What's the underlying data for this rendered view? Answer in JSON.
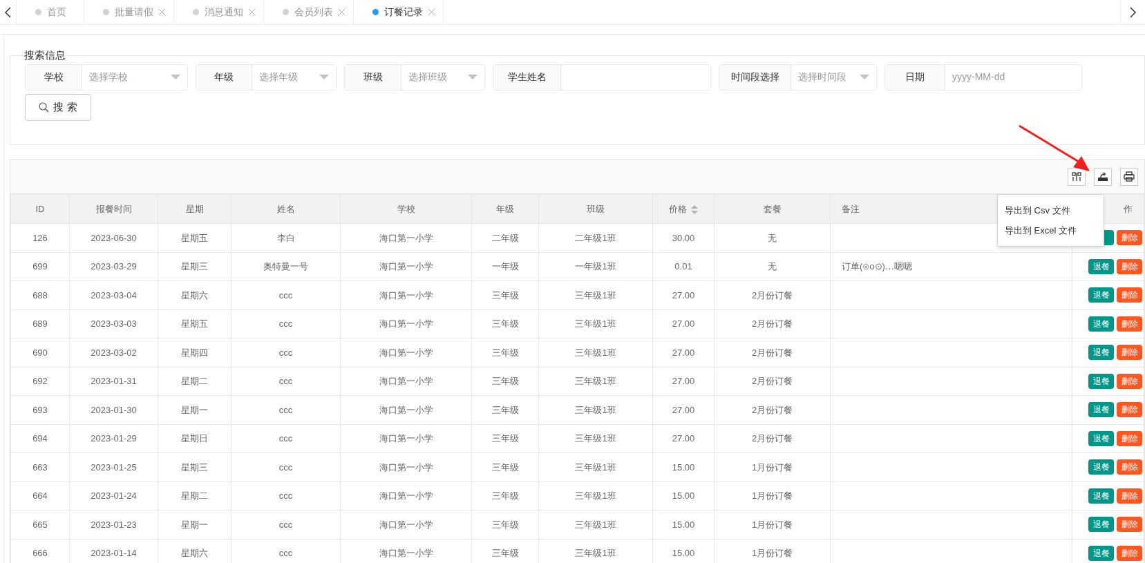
{
  "tabs": [
    {
      "label": "首页",
      "selected": false,
      "closable": false
    },
    {
      "label": "批量请假",
      "selected": false,
      "closable": true
    },
    {
      "label": "消息通知",
      "selected": false,
      "closable": true
    },
    {
      "label": "会员列表",
      "selected": false,
      "closable": true
    },
    {
      "label": "订餐记录",
      "selected": true,
      "closable": true
    }
  ],
  "search": {
    "legend": "搜索信息",
    "fields": [
      {
        "kind": "select",
        "label": "学校",
        "placeholder": "选择学校"
      },
      {
        "kind": "select",
        "label": "年级",
        "placeholder": "选择年级"
      },
      {
        "kind": "select",
        "label": "班级",
        "placeholder": "选择班级"
      },
      {
        "kind": "input",
        "label": "学生姓名"
      },
      {
        "kind": "select",
        "label": "时间段选择",
        "placeholder": "选择时间段"
      },
      {
        "kind": "input",
        "label": "日期",
        "placeholder": "yyyy-MM-dd"
      }
    ],
    "button": "搜 索"
  },
  "export_menu": [
    "导出到 Csv 文件",
    "导出到 Excel 文件"
  ],
  "table": {
    "columns": [
      {
        "label": "ID",
        "sortable": false
      },
      {
        "label": "报餐时间",
        "sortable": false
      },
      {
        "label": "星期",
        "sortable": false
      },
      {
        "label": "姓名",
        "sortable": false
      },
      {
        "label": "学校",
        "sortable": false
      },
      {
        "label": "年级",
        "sortable": false
      },
      {
        "label": "班级",
        "sortable": false
      },
      {
        "label": "价格",
        "sortable": true
      },
      {
        "label": "套餐",
        "sortable": false
      },
      {
        "label": "备注",
        "sortable": false
      },
      {
        "label": "作",
        "sortable": false
      }
    ],
    "rows": [
      {
        "cells": [
          "126",
          "2023-06-30",
          "星期五",
          "李白",
          "海口第一小学",
          "二年级",
          "二年级1班",
          "30.00",
          "无",
          ""
        ],
        "delete": "删除"
      },
      {
        "cells": [
          "699",
          "2023-03-29",
          "星期三",
          "奥特曼一号",
          "海口第一小学",
          "一年级",
          "一年级1班",
          "0.01",
          "无",
          "订单(⊙o⊙)…嗯嗯"
        ],
        "cancel": "退餐",
        "delete": "删除"
      },
      {
        "cells": [
          "688",
          "2023-03-04",
          "星期六",
          "ccc",
          "海口第一小学",
          "三年级",
          "三年级1班",
          "27.00",
          "2月份订餐",
          ""
        ],
        "cancel": "退餐",
        "delete": "删除"
      },
      {
        "cells": [
          "689",
          "2023-03-03",
          "星期五",
          "ccc",
          "海口第一小学",
          "三年级",
          "三年级1班",
          "27.00",
          "2月份订餐",
          ""
        ],
        "cancel": "退餐",
        "delete": "删除"
      },
      {
        "cells": [
          "690",
          "2023-03-02",
          "星期四",
          "ccc",
          "海口第一小学",
          "三年级",
          "三年级1班",
          "27.00",
          "2月份订餐",
          ""
        ],
        "cancel": "退餐",
        "delete": "删除"
      },
      {
        "cells": [
          "692",
          "2023-01-31",
          "星期二",
          "ccc",
          "海口第一小学",
          "三年级",
          "三年级1班",
          "27.00",
          "2月份订餐",
          ""
        ],
        "cancel": "退餐",
        "delete": "删除"
      },
      {
        "cells": [
          "693",
          "2023-01-30",
          "星期一",
          "ccc",
          "海口第一小学",
          "三年级",
          "三年级1班",
          "27.00",
          "2月份订餐",
          ""
        ],
        "cancel": "退餐",
        "delete": "删除"
      },
      {
        "cells": [
          "694",
          "2023-01-29",
          "星期日",
          "ccc",
          "海口第一小学",
          "三年级",
          "三年级1班",
          "27.00",
          "2月份订餐",
          ""
        ],
        "cancel": "退餐",
        "delete": "删除"
      },
      {
        "cells": [
          "663",
          "2023-01-25",
          "星期三",
          "ccc",
          "海口第一小学",
          "三年级",
          "三年级1班",
          "15.00",
          "1月份订餐",
          ""
        ],
        "cancel": "退餐",
        "delete": "删除"
      },
      {
        "cells": [
          "664",
          "2023-01-24",
          "星期二",
          "ccc",
          "海口第一小学",
          "三年级",
          "三年级1班",
          "15.00",
          "1月份订餐",
          ""
        ],
        "cancel": "退餐",
        "delete": "删除"
      },
      {
        "cells": [
          "665",
          "2023-01-23",
          "星期一",
          "ccc",
          "海口第一小学",
          "三年级",
          "三年级1班",
          "15.00",
          "1月份订餐",
          ""
        ],
        "cancel": "退餐",
        "delete": "删除"
      },
      {
        "cells": [
          "666",
          "2023-01-14",
          "星期六",
          "ccc",
          "海口第一小学",
          "三年级",
          "三年级1班",
          "15.00",
          "1月份订餐",
          ""
        ],
        "cancel": "退餐",
        "delete": "删除"
      }
    ]
  }
}
